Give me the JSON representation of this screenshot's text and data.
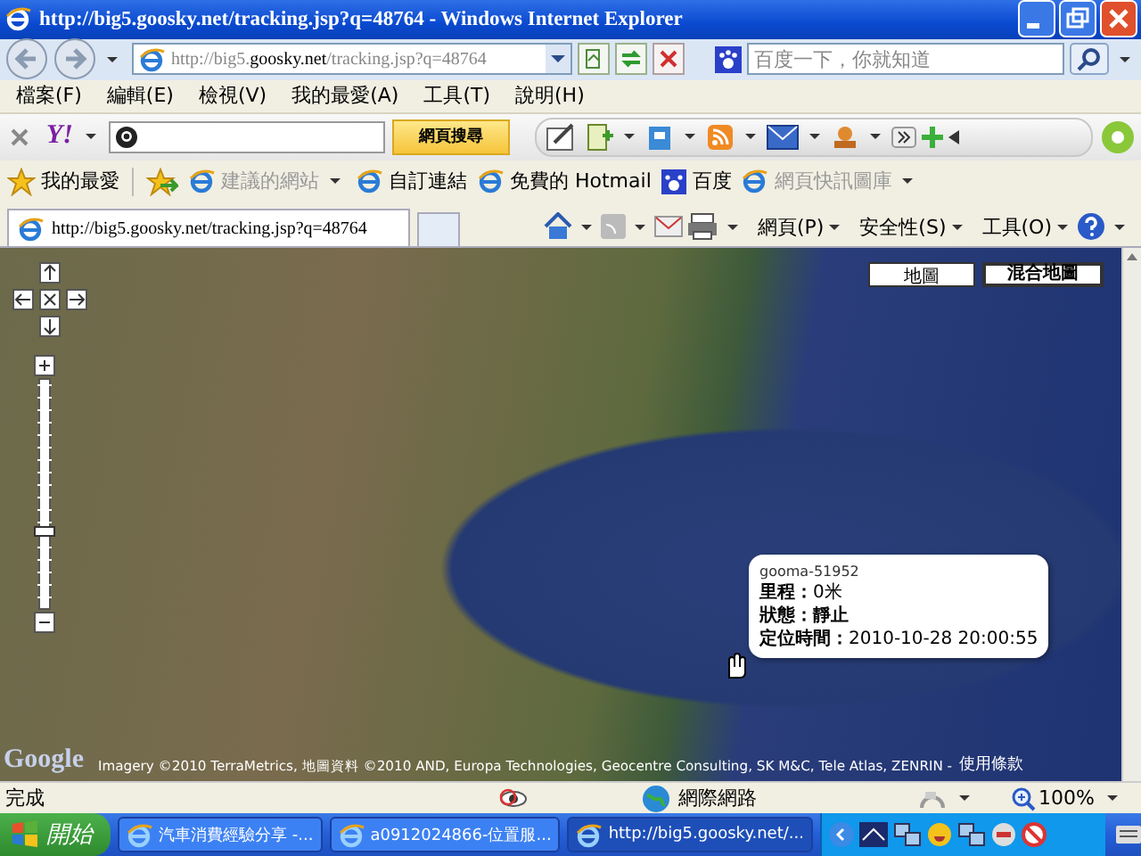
{
  "window": {
    "title": "http://big5.goosky.net/tracking.jsp?q=48764 - Windows Internet Explorer"
  },
  "address_bar": {
    "url": "http://big5.**goosky.net**/tracking.jsp?q=48764"
  },
  "search": {
    "placeholder": "百度一下，你就知道"
  },
  "menu": [
    "檔案(F)",
    "編輯(E)",
    "檢視(V)",
    "我的最愛(A)",
    "工具(T)",
    "說明(H)"
  ],
  "yahoo_toolbar": {
    "logo": "Y!",
    "search_button": "網頁搜尋"
  },
  "favorites_bar": {
    "title": "我的最愛",
    "links": [
      {
        "label": "建議的網站",
        "dimmed": true,
        "has_menu": true
      },
      {
        "label": "自訂連結",
        "dimmed": false,
        "has_menu": false
      },
      {
        "label": "免費的 Hotmail",
        "dimmed": false,
        "has_menu": false
      },
      {
        "label": "百度",
        "dimmed": false,
        "has_menu": false
      },
      {
        "label": "網頁快訊圖庫",
        "dimmed": true,
        "has_menu": true
      }
    ]
  },
  "tabs": [
    {
      "label": "http://big5.goosky.net/tracking.jsp?q=48764",
      "selected": true
    }
  ],
  "command_bar": [
    "網頁(P)",
    "安全性(S)",
    "工具(O)"
  ],
  "map": {
    "type_buttons": [
      {
        "label": "地圖",
        "selected": false
      },
      {
        "label": "混合地圖",
        "selected": true
      }
    ],
    "info_window": {
      "title": "gooma-51952",
      "lines": [
        "**里程：**0米",
        "**狀態：靜止**",
        "**定位時間：**2010-10-28 20:00:55"
      ]
    },
    "zoom": {
      "level": 0.33
    },
    "logo": "Google",
    "attribution": "Imagery ©2010 TerraMetrics, 地圖資料 ©2010 AND, Europa Technologies, Geocentre Consulting, SK M&C, Tele Atlas, ZENRIN -",
    "terms_link": "使用條款"
  },
  "status_bar": {
    "text": "完成",
    "zone": "網際網路",
    "zoom": "100%"
  },
  "taskbar": {
    "start": "開始",
    "tasks": [
      {
        "label": "汽車消費經驗分享 -...",
        "selected": false
      },
      {
        "label": "a0912024866-位置服...",
        "selected": false
      },
      {
        "label": "http://big5.goosky.net/...",
        "selected": true
      }
    ]
  }
}
